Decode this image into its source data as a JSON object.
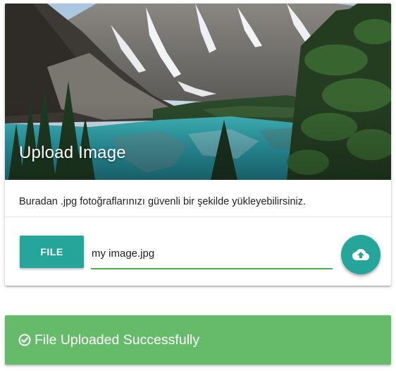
{
  "card": {
    "title": "Upload Image",
    "description": "Buradan .jpg fotoğraflarınızı güvenli bir şekilde yükleyebilirsiniz.",
    "image_icon": "mountain-lake-photo"
  },
  "upload": {
    "file_button_label": "FILE",
    "file_path_value": "my image.jpg",
    "upload_icon": "cloud-upload-icon"
  },
  "alert": {
    "message": "File Uploaded Successfully",
    "icon": "check-circle-icon"
  },
  "colors": {
    "accent": "#26a69a",
    "success": "#66bb6a",
    "input_underline": "#4caf50"
  }
}
